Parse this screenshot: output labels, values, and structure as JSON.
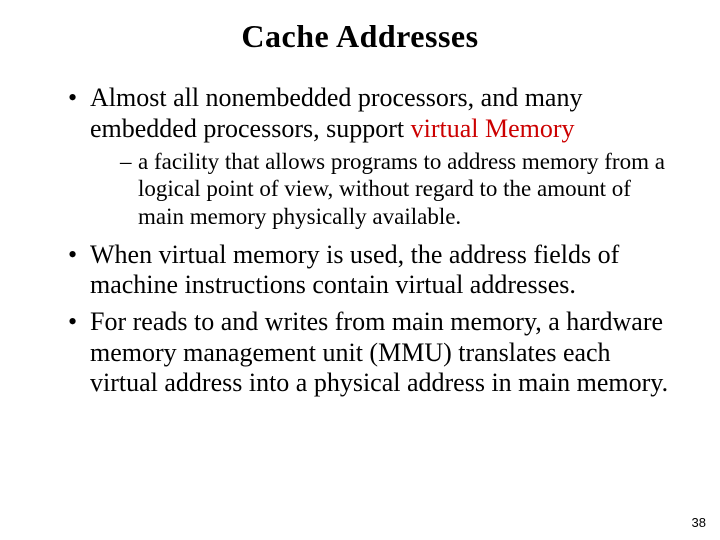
{
  "title": "Cache Addresses",
  "bullets": {
    "b1_pre": "Almost all nonembedded processors, and many embedded processors, support ",
    "b1_vm": "virtual Memory",
    "b1_sub": "a facility that allows programs to address memory from a logical point of view, without regard to the amount of main memory physically available.",
    "b2": "When virtual memory is used, the address fields of machine instructions contain virtual addresses.",
    "b3": "For reads to and writes from main memory, a hardware memory management unit (MMU) translates each virtual address into a physical address in main memory."
  },
  "page_number": "38"
}
